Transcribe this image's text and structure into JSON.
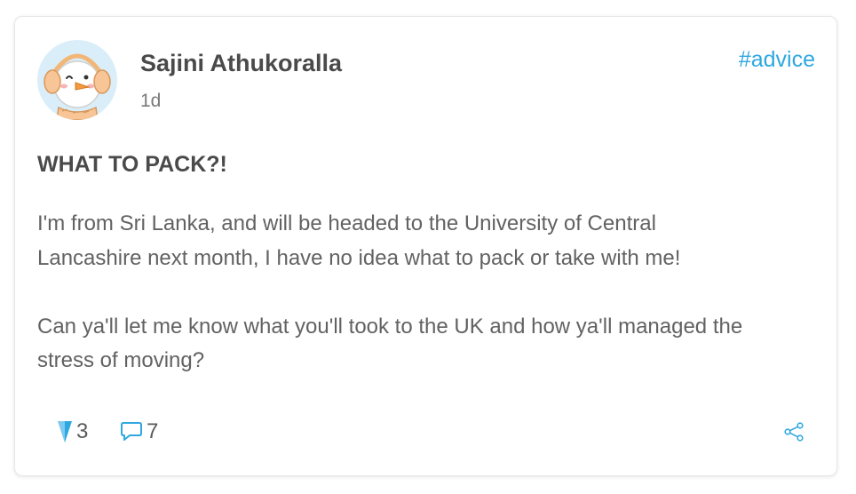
{
  "post": {
    "author": "Sajini Athukoralla",
    "time": "1d",
    "tag": "#advice",
    "title": "WHAT TO PACK?!",
    "paragraphs": [
      "I'm from Sri Lanka, and will be headed to the University of Central\nLancashire next month, I have no idea what to pack or take with me!",
      "Can ya'll let me know what you'll took to the UK and how ya'll managed the\nstress of moving?"
    ],
    "upvotes": "3",
    "comments": "7"
  },
  "icons": {
    "avatar": "snowman-avatar-icon",
    "upvote": "upvote-arrow-icon",
    "comments": "comment-bubble-icon",
    "share": "share-icon"
  },
  "colors": {
    "accent": "#2fa8e0",
    "text": "#4a4a4a",
    "body_text": "#626262"
  }
}
